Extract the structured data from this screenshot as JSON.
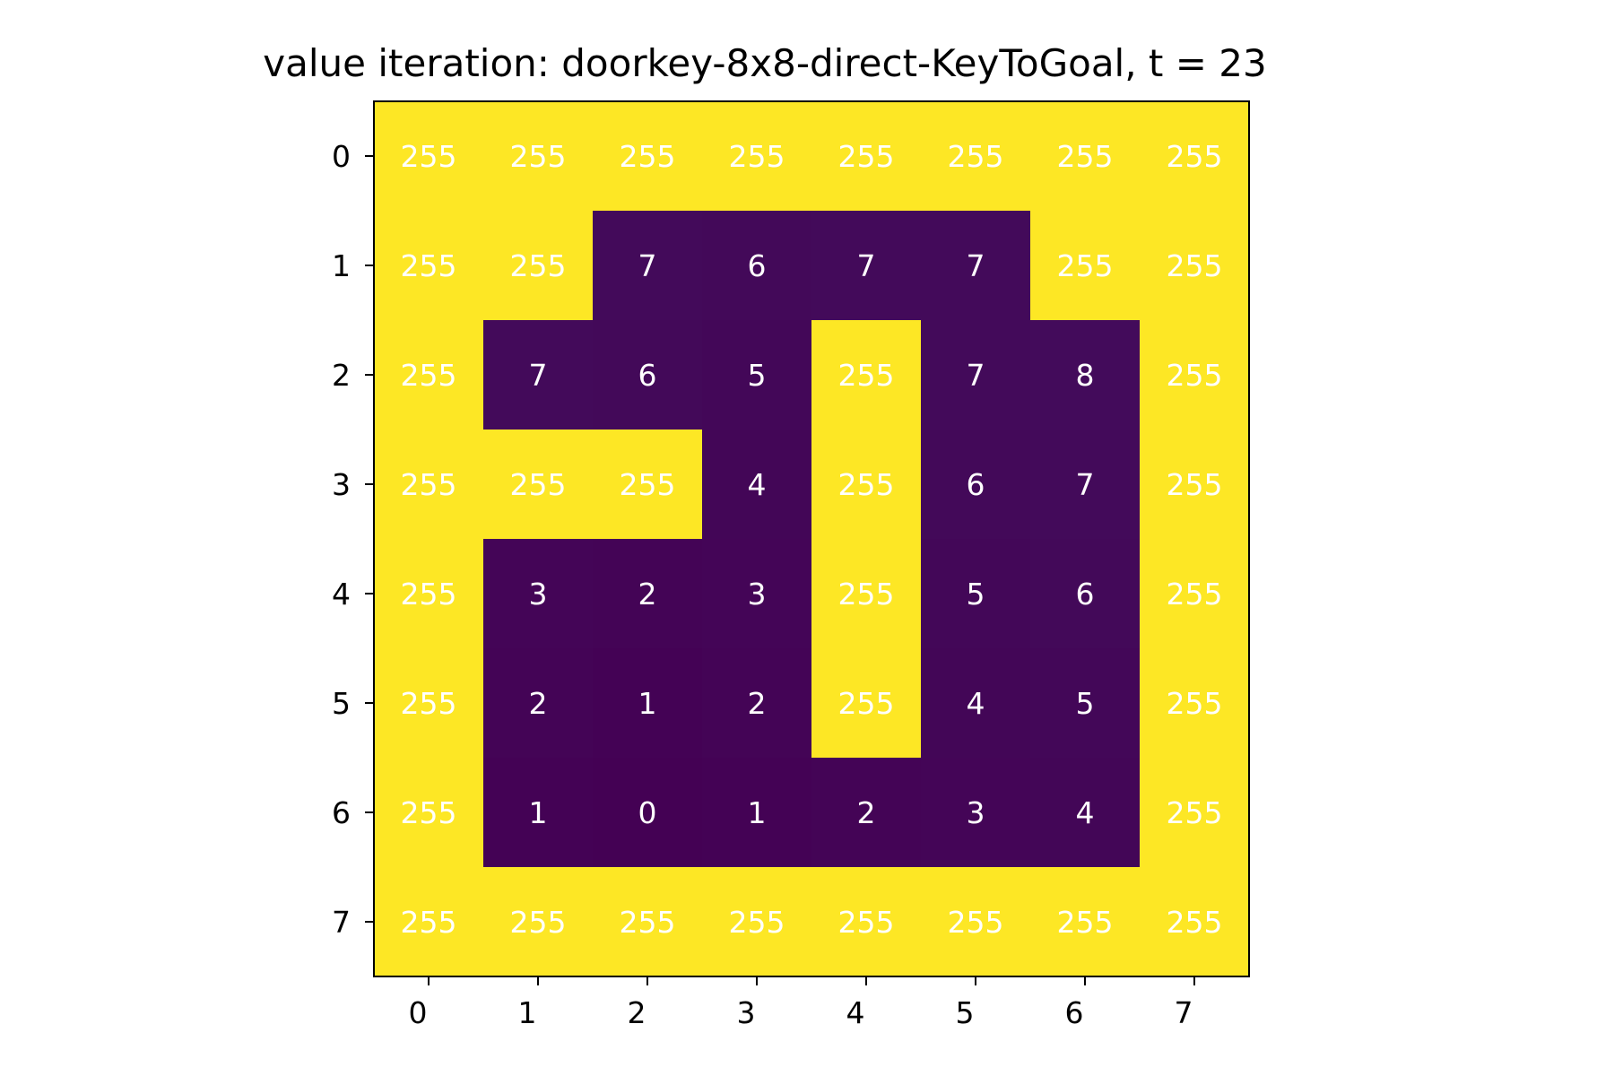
{
  "chart_data": {
    "type": "heatmap",
    "title": "value iteration: doorkey-8x8-direct-KeyToGoal, t = 23",
    "xlabel": "",
    "ylabel": "",
    "x_ticks": [
      "0",
      "1",
      "2",
      "3",
      "4",
      "5",
      "6",
      "7"
    ],
    "y_ticks": [
      "0",
      "1",
      "2",
      "3",
      "4",
      "5",
      "6",
      "7"
    ],
    "colormap": "viridis",
    "vmin": 0,
    "vmax": 255,
    "grid": false,
    "values": [
      [
        255,
        255,
        255,
        255,
        255,
        255,
        255,
        255
      ],
      [
        255,
        255,
        7,
        6,
        7,
        7,
        255,
        255
      ],
      [
        255,
        7,
        6,
        5,
        255,
        7,
        8,
        255
      ],
      [
        255,
        255,
        255,
        4,
        255,
        6,
        7,
        255
      ],
      [
        255,
        3,
        2,
        3,
        255,
        5,
        6,
        255
      ],
      [
        255,
        2,
        1,
        2,
        255,
        4,
        5,
        255
      ],
      [
        255,
        1,
        0,
        1,
        2,
        3,
        4,
        255
      ],
      [
        255,
        255,
        255,
        255,
        255,
        255,
        255,
        255
      ]
    ]
  }
}
